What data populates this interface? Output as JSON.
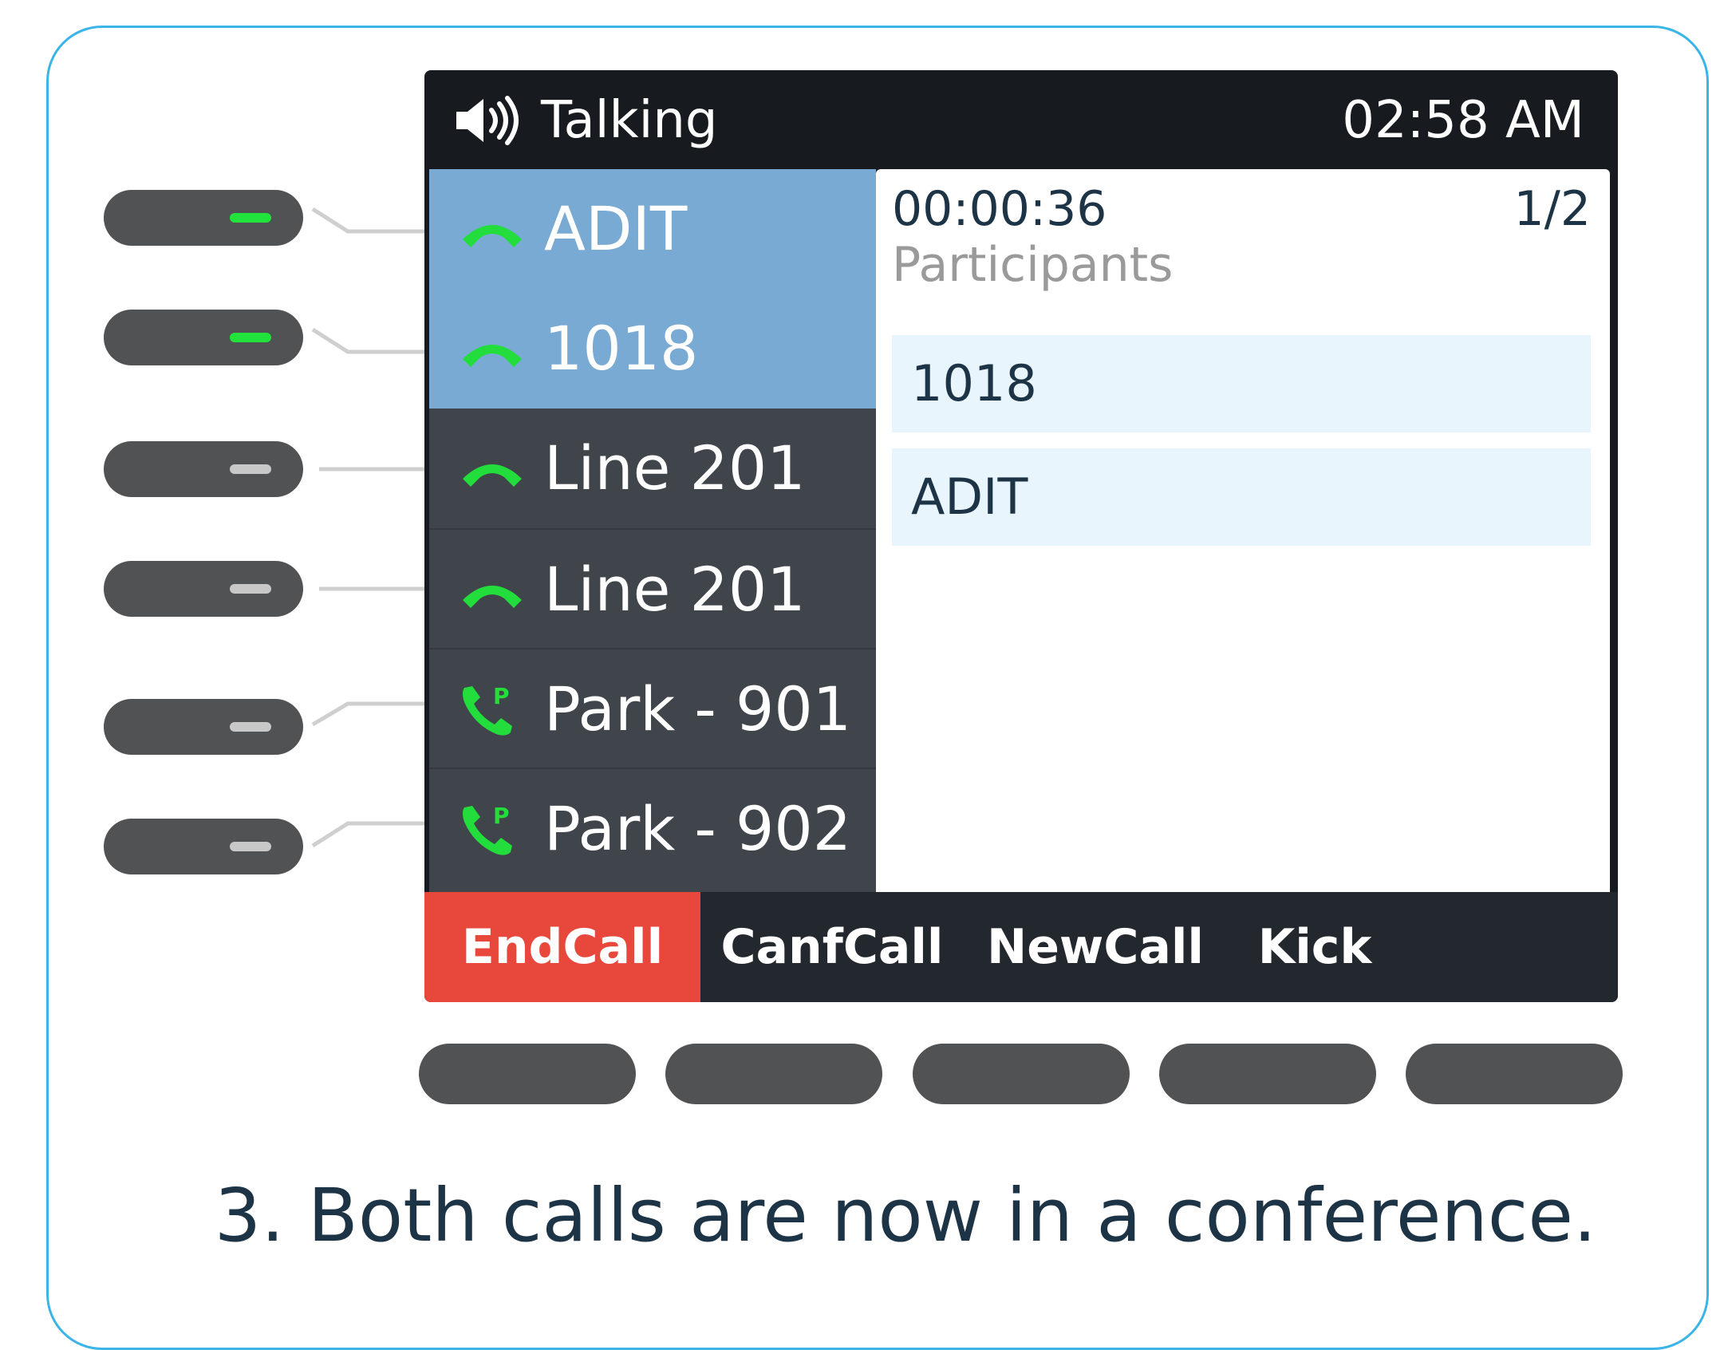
{
  "status_bar": {
    "icon": "speaker-icon",
    "state_text": "Talking",
    "time": "02:58 AM"
  },
  "line_keys": [
    {
      "label": "ADIT",
      "icon": "handset-icon",
      "selected": true,
      "led": "on"
    },
    {
      "label": "1018",
      "icon": "handset-icon",
      "selected": true,
      "led": "on"
    },
    {
      "label": "Line 201",
      "icon": "handset-icon",
      "selected": false,
      "led": "off"
    },
    {
      "label": "Line 201",
      "icon": "handset-icon",
      "selected": false,
      "led": "off"
    },
    {
      "label": "Park - 901",
      "icon": "park-phone-icon",
      "selected": false,
      "led": "off"
    },
    {
      "label": "Park - 902",
      "icon": "park-phone-icon",
      "selected": false,
      "led": "off"
    }
  ],
  "call_detail": {
    "duration": "00:00:36",
    "page": "1/2",
    "section_title": "Participants",
    "participants": [
      "1018",
      "ADIT"
    ]
  },
  "softkeys": [
    "EndCall",
    "CanfCall",
    "NewCall",
    "Kick"
  ],
  "colors": {
    "accent_border": "#3bb4e8",
    "selected_line": "#78aad4",
    "end_call": "#e8473c",
    "led_on": "#22e23c",
    "handset_green": "#22dd3c"
  },
  "caption": "3. Both calls are now in a conference."
}
